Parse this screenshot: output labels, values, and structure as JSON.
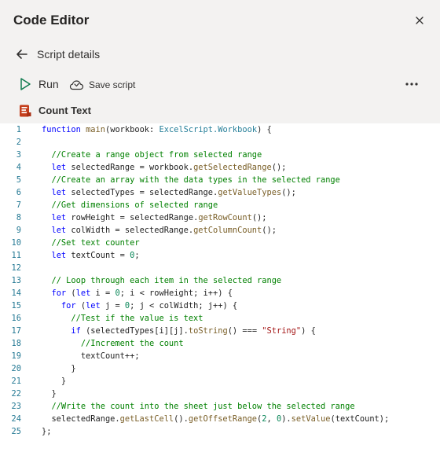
{
  "header": {
    "title": "Code Editor",
    "close_icon": "close-icon"
  },
  "navigation": {
    "back_label": "Script details",
    "back_icon": "arrow-left-icon"
  },
  "toolbar": {
    "run_label": "Run",
    "run_icon": "play-icon",
    "save_label": "Save script",
    "save_icon": "cloud-save-icon",
    "more_icon": "more-icon"
  },
  "script": {
    "name": "Count Text",
    "icon": "script-icon"
  },
  "editor": {
    "line_numbers": [
      "1",
      "2",
      "3",
      "4",
      "5",
      "6",
      "7",
      "8",
      "9",
      "10",
      "11",
      "12",
      "13",
      "14",
      "15",
      "16",
      "17",
      "18",
      "19",
      "20",
      "21",
      "22",
      "23",
      "24",
      "25"
    ],
    "lines": [
      "function main(workbook: ExcelScript.Workbook) {",
      "",
      "  //Create a range object from selected range",
      "  let selectedRange = workbook.getSelectedRange();",
      "  //Create an array with the data types in the selected range",
      "  let selectedTypes = selectedRange.getValueTypes();",
      "  //Get dimensions of selected range",
      "  let rowHeight = selectedRange.getRowCount();",
      "  let colWidth = selectedRange.getColumnCount();",
      "  //Set text counter",
      "  let textCount = 0;",
      "",
      "  // Loop through each item in the selected range",
      "  for (let i = 0; i < rowHeight; i++) {",
      "    for (let j = 0; j < colWidth; j++) {",
      "      //Test if the value is text",
      "      if (selectedTypes[i][j].toString() === \"String\") {",
      "        //Increment the count",
      "        textCount++;",
      "      }",
      "    }",
      "  }",
      "  //Write the count into the sheet just below the selected range",
      "  selectedRange.getLastCell().getOffsetRange(2, 0).setValue(textCount);",
      "};"
    ]
  },
  "colors": {
    "top_background": "#f3f2f1",
    "line_number": "#237893",
    "keyword": "#0000ff",
    "comment": "#008000",
    "function": "#795e26",
    "type": "#267f99",
    "string": "#a31515",
    "number": "#098658",
    "script_icon": "#c43e1c"
  }
}
